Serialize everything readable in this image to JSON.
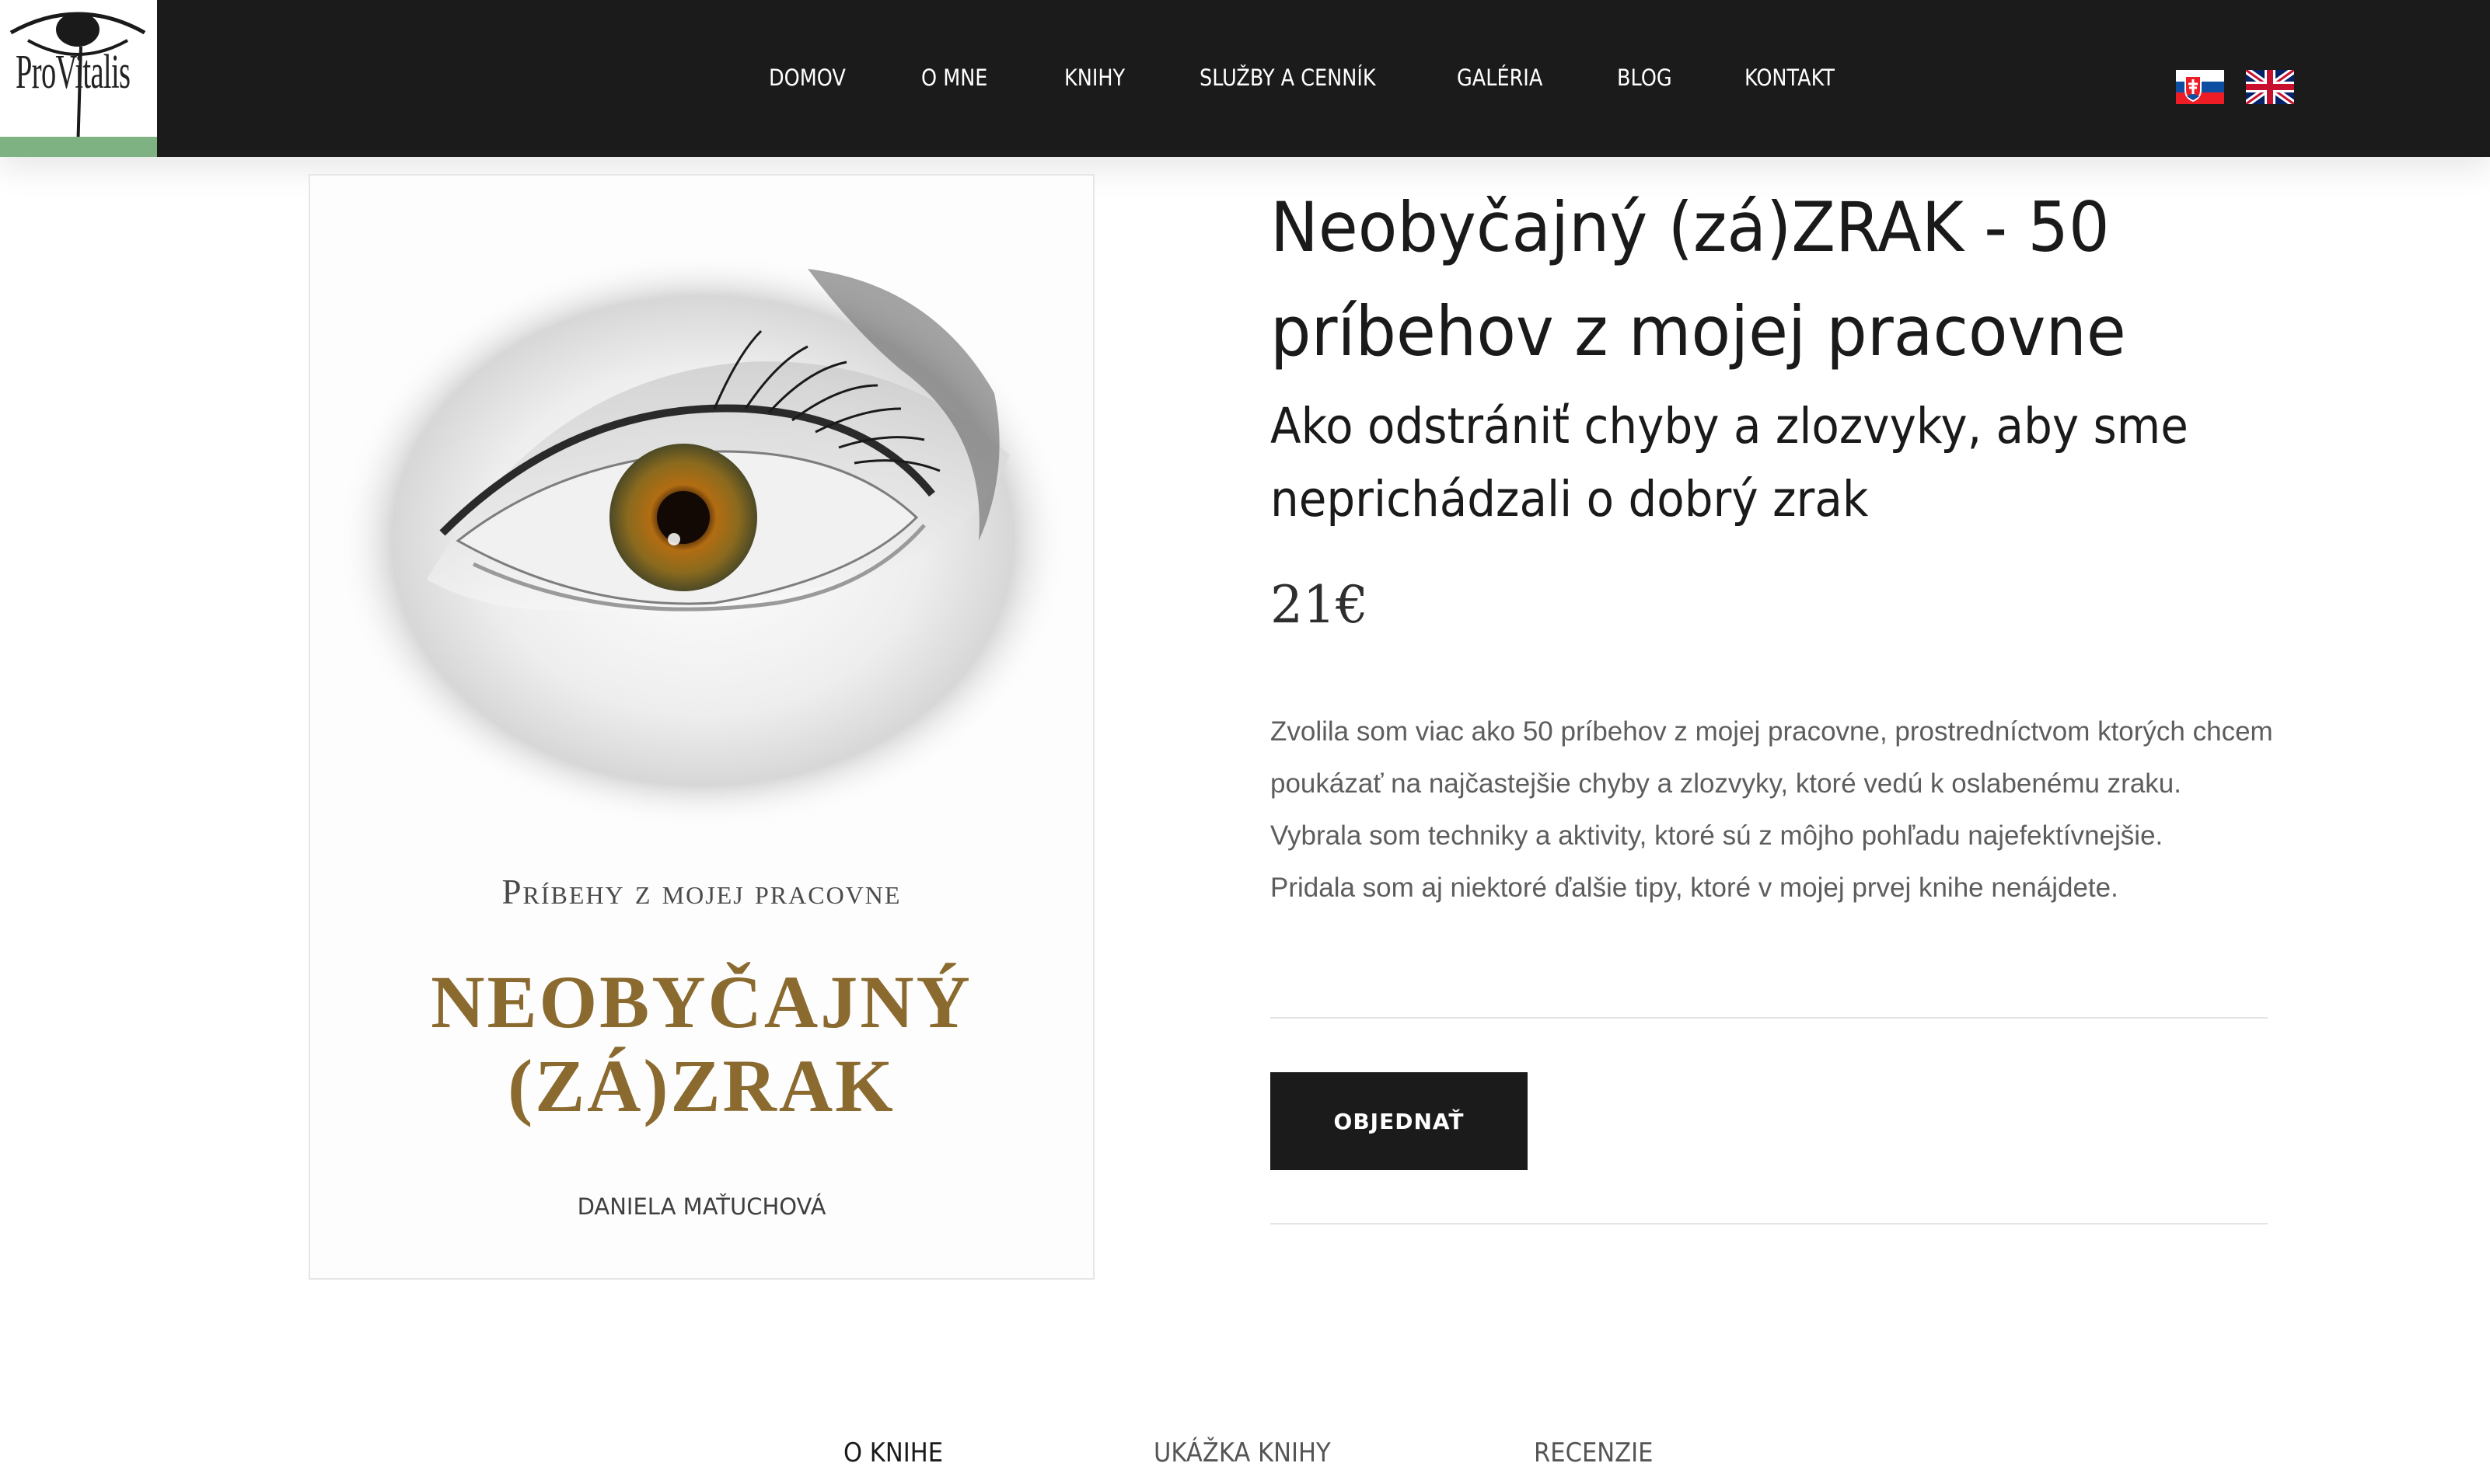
{
  "brand": {
    "logo_text": "ProVitalis"
  },
  "nav": {
    "items": [
      {
        "label": "DOMOV"
      },
      {
        "label": "O MNE"
      },
      {
        "label": "KNIHY"
      },
      {
        "label": "SLUŽBY A CENNÍK"
      },
      {
        "label": "GALÉRIA"
      },
      {
        "label": "BLOG"
      },
      {
        "label": "KONTAKT"
      }
    ]
  },
  "languages": [
    {
      "code": "sk",
      "icon": "slovak-flag-icon"
    },
    {
      "code": "en",
      "icon": "uk-flag-icon"
    }
  ],
  "book_cover": {
    "series": "Príbehy z mojej pracovne",
    "title_line1": "NEOBYČAJNÝ",
    "title_line2": "(ZÁ)ZRAK",
    "author": "DANIELA MAŤUCHOVÁ"
  },
  "product": {
    "title": "Neobyčajný (zá)ZRAK - 50 príbehov z mojej pracovne",
    "subtitle": "Ako odstrániť chyby a zlozvyky, aby sme neprichádzali o dobrý zrak",
    "price": "21€",
    "description": [
      "Zvolila som viac ako 50 príbehov z mojej pracovne, prostredníctvom ktorých chcem poukázať na najčastejšie chyby a zlozvyky, ktoré vedú k oslabenému zraku.",
      "Vybrala som techniky a aktivity, ktoré sú z môjho pohľadu najefektívnejšie.",
      "Pridala som aj niektoré ďalšie tipy, ktoré v mojej prvej knihe nenájdete."
    ],
    "order_label": "OBJEDNAŤ"
  },
  "tabs": [
    {
      "label": "O KNIHE",
      "active": true
    },
    {
      "label": "UKÁŽKA KNIHY",
      "active": false
    },
    {
      "label": "RECENZIE",
      "active": false
    }
  ],
  "colors": {
    "header_bg": "#1b1b1b",
    "logo_accent": "#7fb283",
    "cover_title": "#8a6a2f",
    "button_bg": "#1b1b1b",
    "text_main": "#1a1a1a",
    "text_muted": "#5d5d5d"
  }
}
